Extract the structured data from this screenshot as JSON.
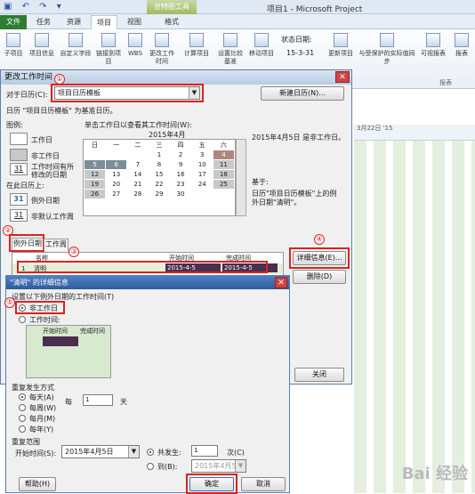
{
  "app": {
    "title": "项目1 - Microsoft Project",
    "context_tab": "甘特图工具"
  },
  "tabs": [
    "文件",
    "任务",
    "资源",
    "项目",
    "视图",
    "格式"
  ],
  "ribbon": {
    "buttons": [
      "子项目",
      "项目信息",
      "自定义字段",
      "链接到项目",
      "WBS",
      "更改工作时间",
      "计算项目",
      "设置比较基准",
      "移动项目",
      "更新项目",
      "与受保护的实际值同步",
      "可视报表",
      "报表"
    ],
    "status_date_label": "状态日期:",
    "status_date_value": "15-3-31",
    "group_label": "报表"
  },
  "gantt": {
    "header": "3月22日 '15"
  },
  "dialog1": {
    "title": "更改工作时间",
    "for_calendar_label": "对于日历(C):",
    "for_calendar_value": "项目日历模板",
    "new_calendar_button": "新建日历(N)...",
    "calendar_info": "日历 \"项目日历模板\" 为基准日历。",
    "legend_title": "图例:",
    "legend": [
      "工作日",
      "非工作日",
      "工作时间有所修改的日期"
    ],
    "on_this_calendar": "在此日历上:",
    "legend2": [
      "例外日期",
      "非默认工作周"
    ],
    "click_hint": "单击工作日以查看其工作时间(W):",
    "month_label": "2015年4月",
    "weekdays": [
      "日",
      "一",
      "二",
      "三",
      "四",
      "五",
      "六"
    ],
    "weeks": [
      [
        "",
        "",
        "",
        "1",
        "2",
        "3",
        "4"
      ],
      [
        "5",
        "6",
        "7",
        "8",
        "9",
        "10",
        "11"
      ],
      [
        "12",
        "13",
        "14",
        "15",
        "16",
        "17",
        "18"
      ],
      [
        "19",
        "20",
        "21",
        "22",
        "23",
        "24",
        "25"
      ],
      [
        "26",
        "27",
        "28",
        "29",
        "30",
        "",
        ""
      ]
    ],
    "right_info1": "2015年4月5日 是非工作日。",
    "right_info2": "基于:",
    "right_info3": "日历\"项目日历模板\"上的例外日期\"清明\"。",
    "tab_exceptions": "例外日期",
    "tab_workweek": "工作周",
    "grid_headers": [
      "名称",
      "开始时间",
      "完成时间"
    ],
    "grid_row": {
      "num": "1",
      "name": "清明",
      "start": "2015-4-5",
      "finish": "2015-4-5"
    },
    "details_button": "详细信息(E)...",
    "delete_button": "删除(D)",
    "close_button": "关闭",
    "annotations": [
      "①",
      "②",
      "③",
      "④",
      "⑤"
    ]
  },
  "dialog2": {
    "title": "\"清明\" 的详细信息",
    "set_working_label": "设置以下例外日期的工作时间(T)",
    "nonworking_option": "非工作日",
    "working_option": "工作时间:",
    "inner_grid_headers": [
      "开始时间",
      "完成时间"
    ],
    "recurrence_label": "重复发生方式",
    "recurrence_options": [
      "每天(A)",
      "每周(W)",
      "每月(M)",
      "每年(Y)"
    ],
    "every_label": "每",
    "every_value": "1",
    "days_label": "天",
    "range_label": "重复范围",
    "start_label": "开始时间(S):",
    "start_value": "2015年4月5日",
    "end_after_label": "共发生:",
    "end_after_value": "1",
    "occurrences_label": "次(C)",
    "end_by_label": "到(B):",
    "end_by_value": "2015年4月5日",
    "help_button": "帮助(H)",
    "ok_button": "确定",
    "cancel_button": "取消"
  },
  "watermark": "Bai 经验"
}
